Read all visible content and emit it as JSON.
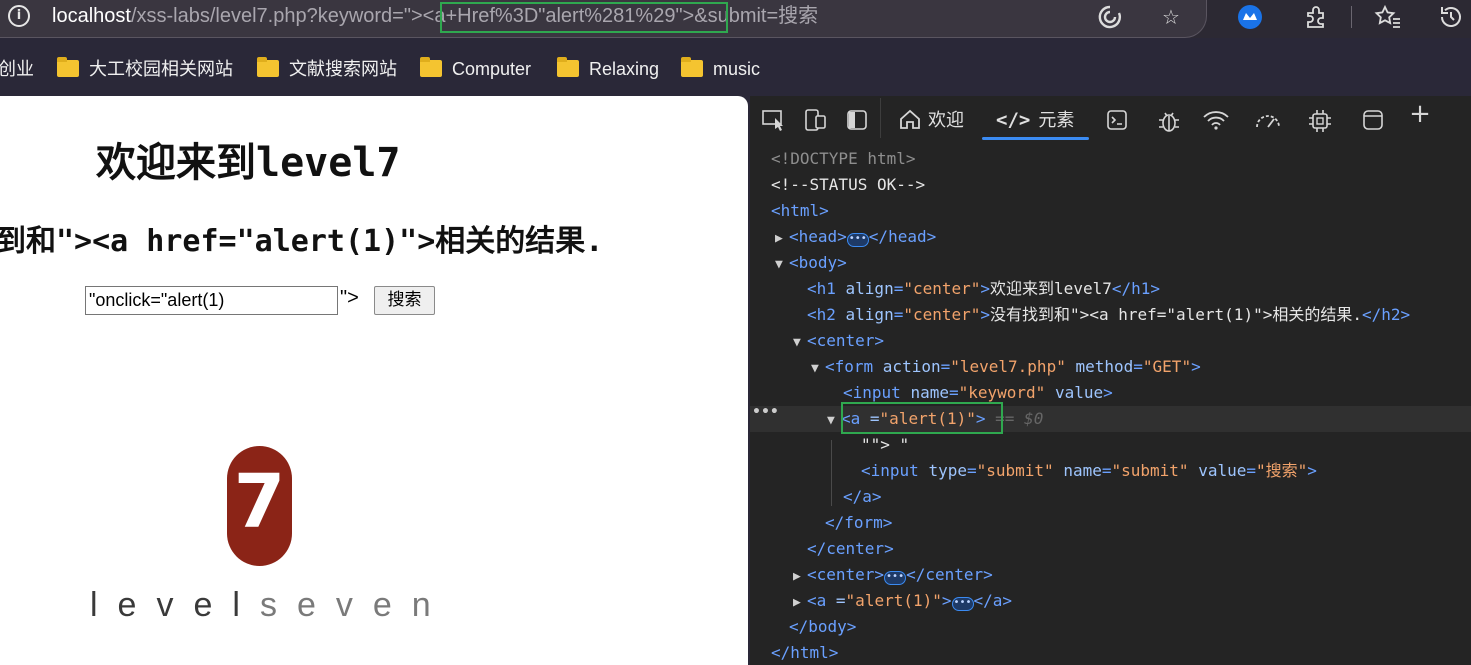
{
  "browser": {
    "url_host": "localhost",
    "url_path_before": "/xss-labs/level7.php?keyword=\">",
    "url_injected": "<a+Href%3D\"alert%281%29\">",
    "url_path_after": "&submit=搜索",
    "icons": [
      "info-icon",
      "immersive-reader-icon",
      "favorite-star-icon",
      "extension-badge-icon",
      "extensions-icon",
      "favorites-icon",
      "history-icon"
    ]
  },
  "bookmarks": [
    {
      "label": "创业"
    },
    {
      "label": "大工校园相关网站"
    },
    {
      "label": "文献搜索网站"
    },
    {
      "label": "Computer"
    },
    {
      "label": "Relaxing"
    },
    {
      "label": "music"
    }
  ],
  "page": {
    "h1": "欢迎来到level7",
    "h2": "到和\"><a href=\"alert(1)\">相关的结果.",
    "input_value": "\"onclick=\"alert(1)",
    "stray_text": "\">",
    "submit_label": "搜索",
    "logo_number": "7",
    "logo_word_dark": "level",
    "logo_word_light": "seven"
  },
  "devtools": {
    "tabs": {
      "welcome": "欢迎",
      "elements": "元素"
    },
    "lines": {
      "l1": "<!DOCTYPE html>",
      "l2": "<!--STATUS OK-->",
      "h1_text": "欢迎来到level7",
      "h2_text": "没有找到和\"><a href=\"alert(1)\">相关的结果.",
      "form_action": "\"level7.php\"",
      "form_method": "\"GET\"",
      "input_name": "\"keyword\"",
      "a_attr": "\"alert(1)\"",
      "sel_marker": "== $0",
      "text_node": "\"\"> \"",
      "submit_type": "\"submit\"",
      "submit_name": "\"submit\"",
      "submit_value": "\"搜索\""
    }
  }
}
